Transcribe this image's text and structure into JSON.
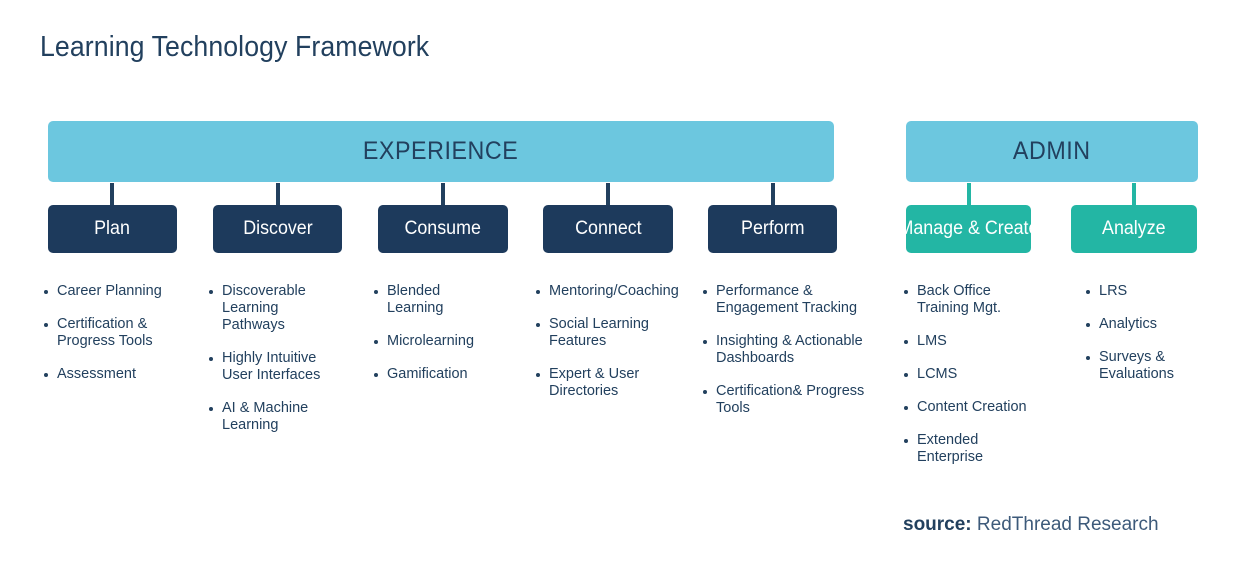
{
  "page": {
    "title": "Learning Technology Framework",
    "background_color": "#ffffff"
  },
  "colors": {
    "navy": "#1d3a5c",
    "text_navy": "#22405e",
    "light_blue": "#6cc7df",
    "teal": "#23b6a4",
    "white": "#ffffff"
  },
  "groups": [
    {
      "id": "experience",
      "header_label": "EXPERIENCE",
      "header_color": "#6cc7df",
      "connector_color": "#22405e",
      "box_color": "#1d3a5c",
      "pillars": [
        {
          "id": "plan",
          "label": "Plan",
          "items": [
            "Career Planning",
            "Certification & Progress Tools",
            "Assessment"
          ]
        },
        {
          "id": "discover",
          "label": "Discover",
          "items": [
            "Discoverable Learning Pathways",
            "Highly Intuitive User Interfaces",
            "AI & Machine Learning"
          ]
        },
        {
          "id": "consume",
          "label": "Consume",
          "items": [
            "Blended Learning",
            "Microlearning",
            "Gamification"
          ]
        },
        {
          "id": "connect",
          "label": "Connect",
          "items": [
            "Mentoring/Coaching",
            "Social Learning Features",
            "Expert & User Directories"
          ]
        },
        {
          "id": "perform",
          "label": "Perform",
          "items": [
            "Performance & Engagement Tracking",
            "Insighting & Actionable Dashboards",
            "Certification& Progress Tools"
          ]
        }
      ]
    },
    {
      "id": "admin",
      "header_label": "ADMIN",
      "header_color": "#6cc7df",
      "connector_color": "#23b6a4",
      "box_color": "#23b6a4",
      "pillars": [
        {
          "id": "manage-create",
          "label": "Manage & Create",
          "items": [
            "Back Office Training Mgt.",
            "LMS",
            "LCMS",
            "Content Creation",
            "Extended Enterprise"
          ]
        },
        {
          "id": "analyze",
          "label": "Analyze",
          "items": [
            "LRS",
            "Analytics",
            "Surveys & Evaluations"
          ]
        }
      ]
    }
  ],
  "source": {
    "label": "source:",
    "value": "RedThread Research"
  }
}
